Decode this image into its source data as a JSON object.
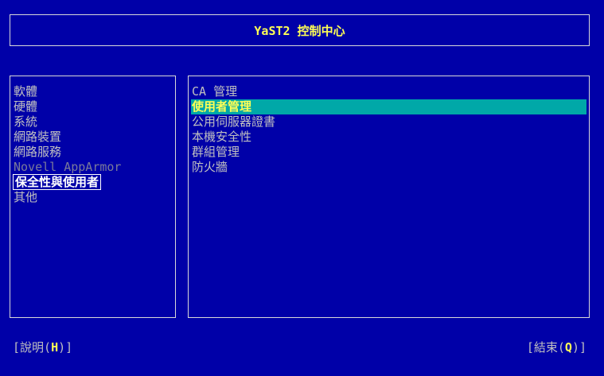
{
  "header": {
    "title": "YaST2 控制中心"
  },
  "categories": [
    {
      "label": "軟體",
      "state": "normal"
    },
    {
      "label": "硬體",
      "state": "normal"
    },
    {
      "label": "系統",
      "state": "normal"
    },
    {
      "label": "網路裝置",
      "state": "normal"
    },
    {
      "label": "網路服務",
      "state": "normal"
    },
    {
      "label": "Novell AppArmor",
      "state": "disabled"
    },
    {
      "label": "保全性與使用者",
      "state": "selected"
    },
    {
      "label": "其他",
      "state": "normal"
    }
  ],
  "modules": [
    {
      "label": "CA 管理",
      "state": "normal"
    },
    {
      "label": "使用者管理",
      "state": "highlight"
    },
    {
      "label": "公用伺服器證書",
      "state": "normal"
    },
    {
      "label": "本機安全性",
      "state": "normal"
    },
    {
      "label": "群組管理",
      "state": "normal"
    },
    {
      "label": "防火牆",
      "state": "normal"
    }
  ],
  "footer": {
    "help": {
      "prefix": "[說明(",
      "hotkey": "H",
      "suffix": ")]"
    },
    "quit": {
      "prefix": "[結束(",
      "hotkey": "Q",
      "suffix": ")]"
    }
  },
  "colors": {
    "background": "#0000a8",
    "text": "#c0c0c0",
    "accent": "#ffff55",
    "highlight": "#00a8a8",
    "disabled": "#7a7a9a"
  }
}
